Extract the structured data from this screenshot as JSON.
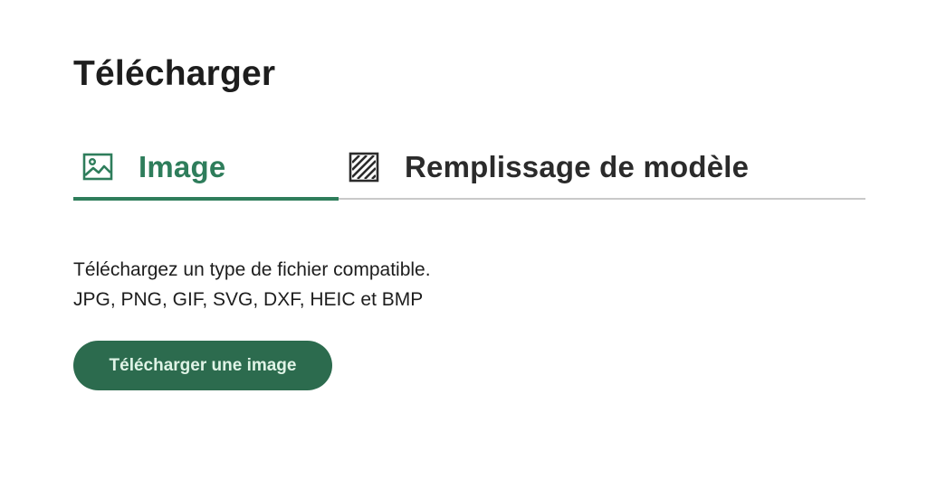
{
  "header": {
    "title": "Télécharger"
  },
  "tabs": [
    {
      "label": "Image",
      "icon": "image-icon",
      "active": true
    },
    {
      "label": "Remplissage de modèle",
      "icon": "pattern-fill-icon",
      "active": false
    }
  ],
  "content": {
    "line1": "Téléchargez un type de fichier compatible.",
    "line2": "JPG, PNG, GIF, SVG, DXF, HEIC et BMP"
  },
  "upload_button": {
    "label": "Télécharger une image"
  },
  "colors": {
    "accent": "#2e7d5b",
    "button_bg": "#2c6b4e",
    "button_text": "#dff3e6",
    "text": "#1d1d1d",
    "divider": "#c9c9c9"
  }
}
